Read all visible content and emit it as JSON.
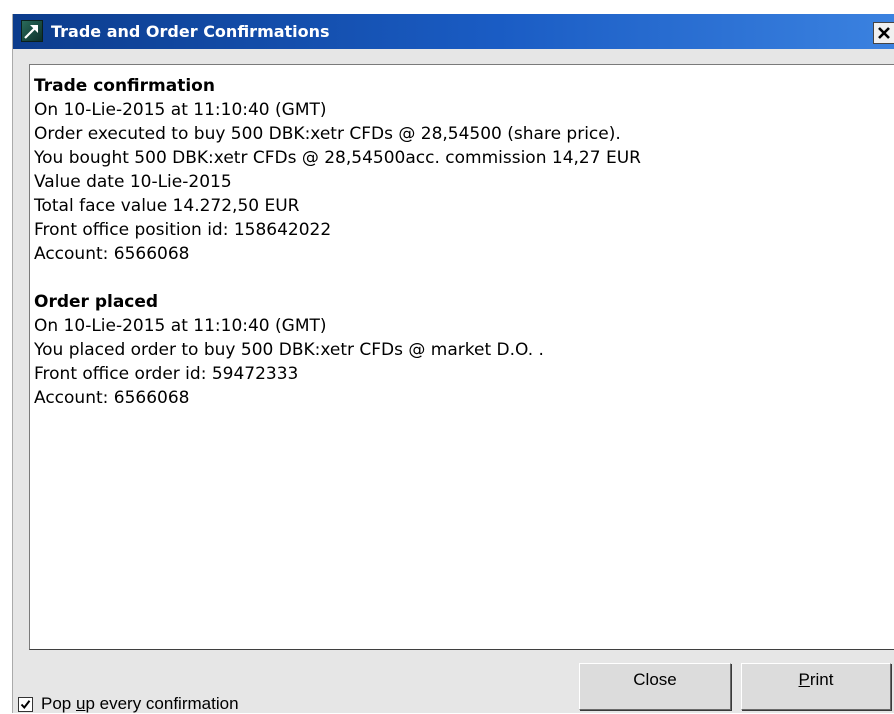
{
  "window": {
    "title": "Trade and Order Confirmations",
    "titlebar_gradient": [
      "#0c3c8c",
      "#3b82e0"
    ]
  },
  "trade": {
    "heading": "Trade confirmation",
    "lines": [
      "On 10-Lie-2015 at 11:10:40 (GMT)",
      "Order executed to buy 500 DBK:xetr CFDs @ 28,54500 (share price).",
      "You bought 500 DBK:xetr CFDs @ 28,54500acc. commission 14,27 EUR",
      "Value date 10-Lie-2015",
      "Total face value 14.272,50 EUR",
      "Front office position id: 158642022",
      "Account: 6566068"
    ]
  },
  "order": {
    "heading": "Order placed",
    "lines": [
      "On 10-Lie-2015 at 11:10:40 (GMT)",
      "You placed order to buy 500 DBK:xetr CFDs @ market D.O. .",
      "Front office order id: 59472333",
      "Account: 6566068"
    ]
  },
  "footer": {
    "checkbox_checked": true,
    "checkbox_label_before": "Pop ",
    "checkbox_label_mnemonic": "u",
    "checkbox_label_after": "p every confirmation",
    "close_label": "Close",
    "print_mnemonic": "P",
    "print_rest": "rint"
  },
  "icons": {
    "app": "arrow-app-icon",
    "close": "close-icon",
    "check": "checkmark-icon"
  }
}
